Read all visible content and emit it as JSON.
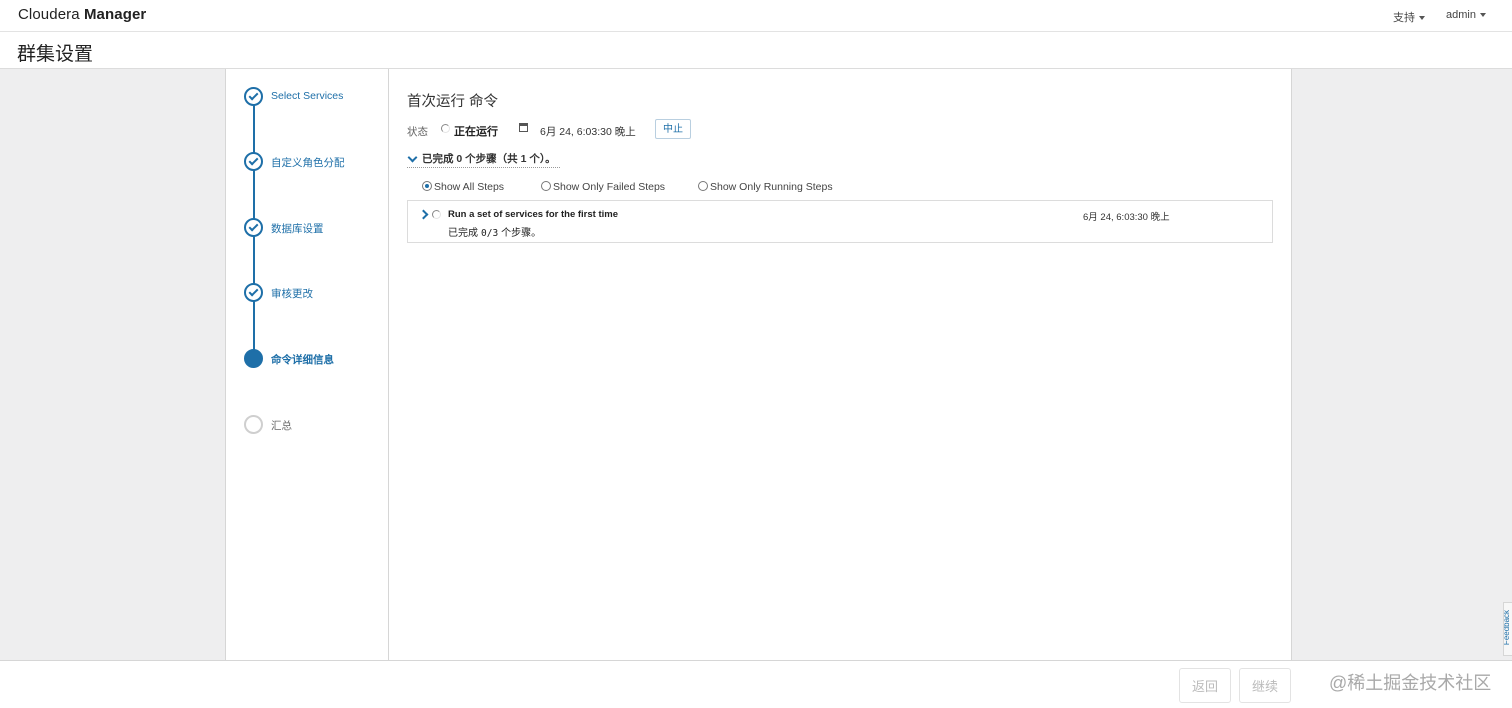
{
  "header": {
    "brand_light": "Cloudera ",
    "brand_bold": "Manager",
    "support_label": "支持",
    "user_label": "admin"
  },
  "page": {
    "title": "群集设置"
  },
  "wizard": {
    "steps": [
      {
        "label": "Select Services",
        "state": "done"
      },
      {
        "label": "自定义角色分配",
        "state": "done"
      },
      {
        "label": "数据库设置",
        "state": "done"
      },
      {
        "label": "审核更改",
        "state": "done"
      },
      {
        "label": "命令详细信息",
        "state": "current"
      },
      {
        "label": "汇总",
        "state": "pending"
      }
    ]
  },
  "command": {
    "title": "首次运行 命令",
    "status_label": "状态",
    "status_value": "正在运行",
    "status_time": "6月 24, 6:03:30 晚上",
    "abort_label": "中止",
    "summary": "已完成 0 个步骤（共 1 个）。",
    "filters": [
      {
        "label": "Show All Steps",
        "checked": true
      },
      {
        "label": "Show Only Failed Steps",
        "checked": false
      },
      {
        "label": "Show Only Running Steps",
        "checked": false
      }
    ],
    "steps": [
      {
        "name": "Run a set of services for the first time",
        "progress_prefix": "已完成",
        "progress_value": "0/3",
        "progress_suffix": "个步骤。",
        "time": "6月 24, 6:03:30 晚上"
      }
    ]
  },
  "footer": {
    "back_label": "返回",
    "continue_label": "继续",
    "watermark": "@稀土掘金技术社区"
  },
  "feedback": {
    "label": "Feedback"
  },
  "colors": {
    "accent": "#1e6fa8",
    "background": "#eeeeef"
  }
}
